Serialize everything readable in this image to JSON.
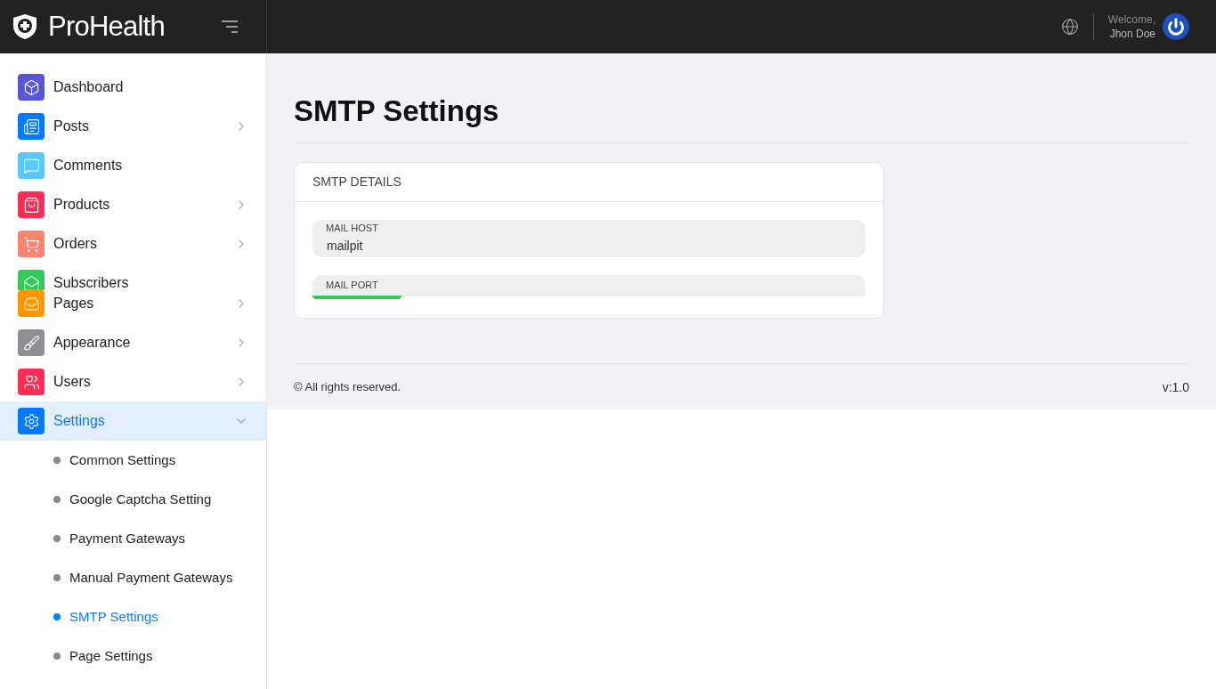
{
  "brand": {
    "name": "ProHealth"
  },
  "header": {
    "welcome": "Welcome,",
    "user": "Jhon Doe"
  },
  "sidebar": {
    "items": [
      {
        "label": "Dashboard",
        "kind": "row",
        "color": "#5856d6",
        "has_children": false,
        "selected": false
      },
      {
        "label": "Posts",
        "kind": "row",
        "color": "#007aff",
        "has_children": true,
        "selected": false
      },
      {
        "label": "Comments",
        "kind": "row",
        "color": "#5ac8fa",
        "has_children": false,
        "selected": false
      },
      {
        "label": "Products",
        "kind": "row",
        "color": "#ff2d55",
        "has_children": true,
        "selected": false
      },
      {
        "label": "Orders",
        "kind": "row",
        "color": "#fc8370",
        "has_children": true,
        "selected": false
      },
      {
        "label": "Subscribers",
        "kind": "clipped",
        "color": "#34c759",
        "has_children": false,
        "selected": false
      },
      {
        "label": "Pages",
        "kind": "tight",
        "color": "#ff9500",
        "has_children": true,
        "selected": false
      },
      {
        "label": "Appearance",
        "kind": "row",
        "color": "#8e8e93",
        "has_children": true,
        "selected": false
      },
      {
        "label": "Users",
        "kind": "row",
        "color": "#ff2d55",
        "has_children": true,
        "selected": false
      },
      {
        "label": "Settings",
        "kind": "row",
        "color": "#007aff",
        "has_children": true,
        "selected": true,
        "expanded": true,
        "children": [
          {
            "label": "Common Settings",
            "selected": false
          },
          {
            "label": "Google Captcha Setting",
            "selected": false
          },
          {
            "label": "Payment Gateways",
            "selected": false
          },
          {
            "label": "Manual Payment Gateways",
            "selected": false
          },
          {
            "label": "SMTP Settings",
            "selected": true
          },
          {
            "label": "Page Settings",
            "selected": false
          }
        ]
      }
    ]
  },
  "page": {
    "title": "SMTP Settings"
  },
  "card": {
    "title": "SMTP DETAILS",
    "fields": [
      {
        "label": "MAIL HOST",
        "value": "mailpit",
        "kind": "full"
      },
      {
        "label": "MAIL PORT",
        "kind": "clipped"
      }
    ]
  },
  "footer": {
    "copyright": "© All rights reserved.",
    "version": "v:1.0"
  }
}
